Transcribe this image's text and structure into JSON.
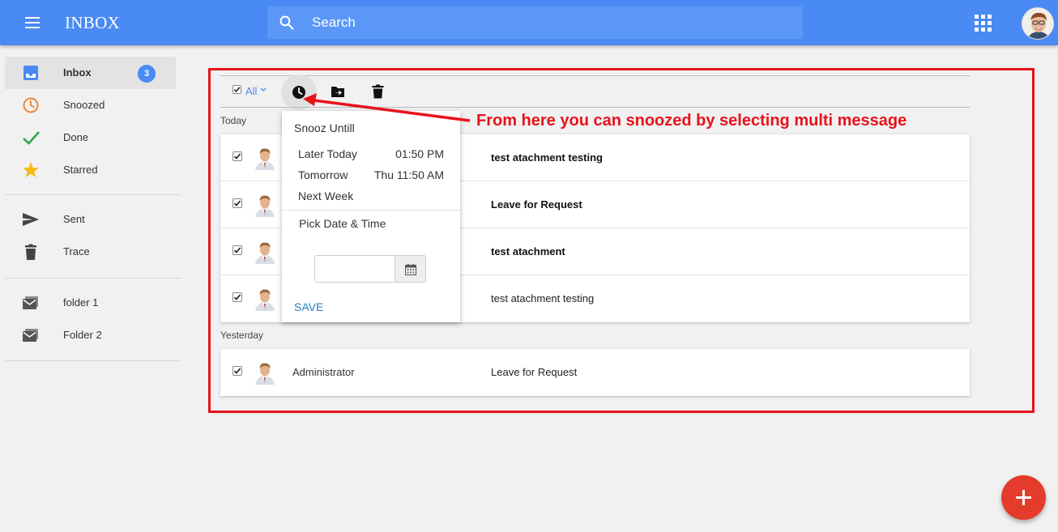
{
  "header": {
    "title": "INBOX",
    "search_placeholder": "Search"
  },
  "sidebar": {
    "items": [
      {
        "label": "Inbox",
        "badge": "3",
        "icon": "inbox-icon"
      },
      {
        "label": "Snoozed",
        "icon": "clock-icon"
      },
      {
        "label": "Done",
        "icon": "checkmark-icon"
      },
      {
        "label": "Starred",
        "icon": "star-icon"
      },
      {
        "label": "Sent",
        "icon": "send-icon"
      },
      {
        "label": "Trace",
        "icon": "trash-icon"
      },
      {
        "label": "folder 1",
        "icon": "mail-folder-icon"
      },
      {
        "label": "Folder 2",
        "icon": "mail-folder-icon"
      }
    ]
  },
  "toolbar": {
    "select_label": "All"
  },
  "sections": [
    {
      "label": "Today",
      "messages": [
        {
          "sender": "",
          "subject": "test atachment testing",
          "unread": true
        },
        {
          "sender": "",
          "subject": "Leave for Request",
          "unread": true
        },
        {
          "sender": "",
          "subject": "test atachment",
          "unread": true
        },
        {
          "sender": "",
          "subject": "test atachment testing",
          "unread": false
        }
      ]
    },
    {
      "label": "Yesterday",
      "messages": [
        {
          "sender": "Administrator",
          "subject": "Leave for Request",
          "unread": false
        }
      ]
    }
  ],
  "snooze_menu": {
    "title": "Snooz Untill",
    "options": [
      {
        "label": "Later Today",
        "time": "01:50 PM"
      },
      {
        "label": "Tomorrow",
        "time": "Thu 11:50 AM"
      },
      {
        "label": "Next Week",
        "time": ""
      }
    ],
    "pick_label": "Pick Date & Time",
    "date_value": "",
    "save_label": "SAVE"
  },
  "annotation": {
    "text": "From here you can snoozed by selecting multi message"
  },
  "colors": {
    "accent": "#4a8af4",
    "annotation": "#e8121b",
    "fab": "#e53b2c"
  }
}
